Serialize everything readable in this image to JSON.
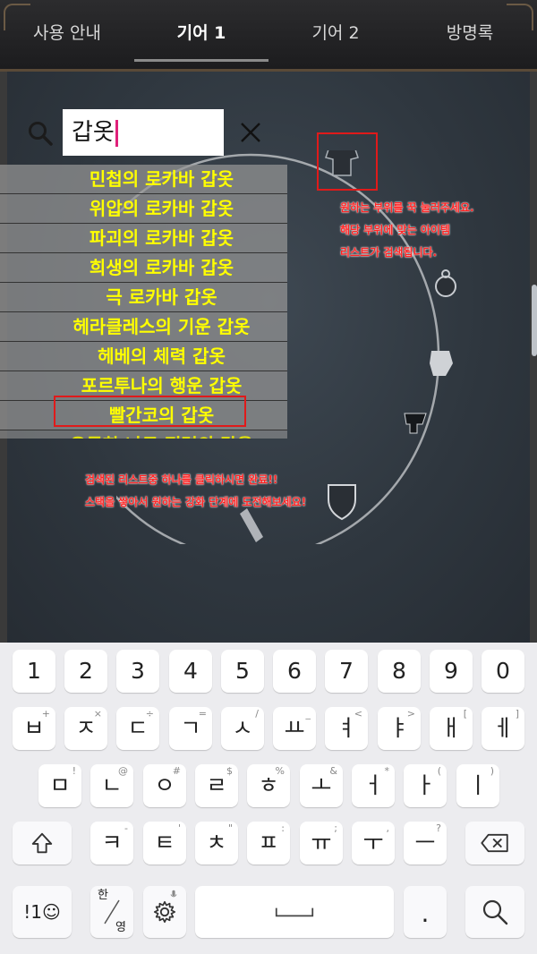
{
  "tabs": [
    "사용 안내",
    "기어 1",
    "기어 2",
    "방명록"
  ],
  "active_tab": "기어 1",
  "search": {
    "value": "갑옷"
  },
  "results": [
    "민첩의 로카바 갑옷",
    "위압의 로카바 갑옷",
    "파괴의 로카바 갑옷",
    "희생의 로카바 갑옷",
    "극 로카바 갑옷",
    "헤라클레스의 기운 갑옷",
    "헤베의 체력 갑옷",
    "포르투나의 행운 갑옷",
    "빨간코의 갑옷",
    "우둔한 나무 정령의 갑옷"
  ],
  "notes": {
    "slot_hint_1": "원하는 부위를 꾹 눌러주세요.",
    "slot_hint_2": "해당 부위에 맞는 아이템",
    "slot_hint_3": "리스트가 검색됩니다.",
    "result_hint_1": "검색된 리스트중 하나를 클릭하시면 완료!!",
    "result_hint_2": "스택을 쌓아서 원하는 강화 단계에 도전해보세요!"
  },
  "colors": {
    "result_text": "#ffff00",
    "highlight": "#e01a1a",
    "note_text": "#ff2424"
  },
  "keyboard": {
    "row1": [
      "1",
      "2",
      "3",
      "4",
      "5",
      "6",
      "7",
      "8",
      "9",
      "0"
    ],
    "row2": [
      [
        "ㅂ",
        "+"
      ],
      [
        "ㅈ",
        "×"
      ],
      [
        "ㄷ",
        "÷"
      ],
      [
        "ㄱ",
        "="
      ],
      [
        "ㅅ",
        "/"
      ],
      [
        "ㅛ",
        "_"
      ],
      [
        "ㅕ",
        "<"
      ],
      [
        "ㅑ",
        ">"
      ],
      [
        "ㅐ",
        "["
      ],
      [
        "ㅔ",
        "]"
      ]
    ],
    "row3": [
      [
        "ㅁ",
        "!"
      ],
      [
        "ㄴ",
        "@"
      ],
      [
        "ㅇ",
        "#"
      ],
      [
        "ㄹ",
        "$"
      ],
      [
        "ㅎ",
        "%"
      ],
      [
        "ㅗ",
        "&"
      ],
      [
        "ㅓ",
        "*"
      ],
      [
        "ㅏ",
        "("
      ],
      [
        "ㅣ",
        ")"
      ]
    ],
    "row4": [
      [
        "ㅋ",
        "-"
      ],
      [
        "ㅌ",
        "'"
      ],
      [
        "ㅊ",
        "\""
      ],
      [
        "ㅍ",
        ":"
      ],
      [
        "ㅠ",
        ";"
      ],
      [
        "ㅜ",
        ","
      ],
      [
        "ㅡ",
        "?"
      ]
    ],
    "symbols_label": "!1☺",
    "lang_label_top": "한",
    "lang_label_bottom": "영",
    "period_label": "."
  }
}
